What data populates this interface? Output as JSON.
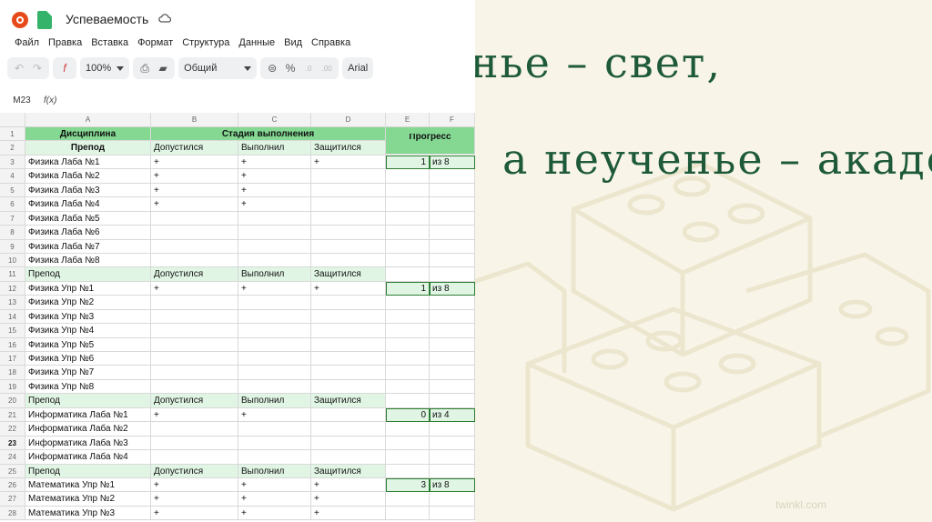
{
  "slide": {
    "line1": "Ученье – свет,",
    "line2": "а неученье – акаде",
    "watermark": "twinkl.com",
    "colors": {
      "title": "#1e5a3a",
      "background": "#f8f5e8"
    }
  },
  "app": {
    "title": "Успеваемость",
    "menu": [
      "Файл",
      "Правка",
      "Вставка",
      "Формат",
      "Структура",
      "Данные",
      "Вид",
      "Справка"
    ],
    "toolbar": {
      "zoom": "100%",
      "format": "Общий",
      "font": "Arial",
      "percent": "%",
      "dec_minus": ".0",
      "dec_plus": ".00"
    },
    "formula_bar": {
      "cell_ref": "M23",
      "fx": "f(x)"
    },
    "columns": [
      "A",
      "B",
      "C",
      "D",
      "E",
      "F"
    ],
    "header": {
      "discipline": "Дисциплина",
      "stage": "Стадия выполнения",
      "progress": "Прогресс",
      "teacher": "Препод",
      "admitted": "Допустился",
      "done": "Выполнил",
      "defended": "Защитился"
    },
    "rows": [
      {
        "n": "3",
        "a": "Физика Лаба №1",
        "b": "+",
        "c": "+",
        "d": "+",
        "e": "1",
        "f": "из 8"
      },
      {
        "n": "4",
        "a": "Физика Лаба №2",
        "b": "+",
        "c": "+",
        "d": "",
        "e": "",
        "f": ""
      },
      {
        "n": "5",
        "a": "Физика Лаба №3",
        "b": "+",
        "c": "+",
        "d": "",
        "e": "",
        "f": ""
      },
      {
        "n": "6",
        "a": "Физика Лаба №4",
        "b": "+",
        "c": "+",
        "d": "",
        "e": "",
        "f": ""
      },
      {
        "n": "7",
        "a": "Физика Лаба №5",
        "b": "",
        "c": "",
        "d": "",
        "e": "",
        "f": ""
      },
      {
        "n": "8",
        "a": "Физика Лаба №6",
        "b": "",
        "c": "",
        "d": "",
        "e": "",
        "f": ""
      },
      {
        "n": "9",
        "a": "Физика Лаба №7",
        "b": "",
        "c": "",
        "d": "",
        "e": "",
        "f": ""
      },
      {
        "n": "10",
        "a": "Физика Лаба №8",
        "b": "",
        "c": "",
        "d": "",
        "e": "",
        "f": ""
      },
      {
        "n": "11",
        "a": "Препод",
        "b": "Допустился",
        "c": "Выполнил",
        "d": "Защитился",
        "e": "",
        "f": "",
        "sub": true
      },
      {
        "n": "12",
        "a": "Физика Упр №1",
        "b": "+",
        "c": "+",
        "d": "+",
        "e": "1",
        "f": "из 8"
      },
      {
        "n": "13",
        "a": "Физика Упр №2",
        "b": "",
        "c": "",
        "d": "",
        "e": "",
        "f": ""
      },
      {
        "n": "14",
        "a": "Физика Упр №3",
        "b": "",
        "c": "",
        "d": "",
        "e": "",
        "f": ""
      },
      {
        "n": "15",
        "a": "Физика Упр №4",
        "b": "",
        "c": "",
        "d": "",
        "e": "",
        "f": ""
      },
      {
        "n": "16",
        "a": "Физика Упр №5",
        "b": "",
        "c": "",
        "d": "",
        "e": "",
        "f": ""
      },
      {
        "n": "17",
        "a": "Физика Упр №6",
        "b": "",
        "c": "",
        "d": "",
        "e": "",
        "f": ""
      },
      {
        "n": "18",
        "a": "Физика Упр №7",
        "b": "",
        "c": "",
        "d": "",
        "e": "",
        "f": ""
      },
      {
        "n": "19",
        "a": "Физика Упр №8",
        "b": "",
        "c": "",
        "d": "",
        "e": "",
        "f": ""
      },
      {
        "n": "20",
        "a": "Препод",
        "b": "Допустился",
        "c": "Выполнил",
        "d": "Защитился",
        "e": "",
        "f": "",
        "sub": true
      },
      {
        "n": "21",
        "a": "Информатика Лаба №1",
        "b": "+",
        "c": "+",
        "d": "",
        "e": "0",
        "f": "из 4"
      },
      {
        "n": "22",
        "a": "Информатика Лаба №2",
        "b": "",
        "c": "",
        "d": "",
        "e": "",
        "f": ""
      },
      {
        "n": "23",
        "a": "Информатика Лаба №3",
        "b": "",
        "c": "",
        "d": "",
        "e": "",
        "f": "",
        "hl": true
      },
      {
        "n": "24",
        "a": "Информатика Лаба №4",
        "b": "",
        "c": "",
        "d": "",
        "e": "",
        "f": ""
      },
      {
        "n": "25",
        "a": "Препод",
        "b": "Допустился",
        "c": "Выполнил",
        "d": "Защитился",
        "e": "",
        "f": "",
        "sub": true
      },
      {
        "n": "26",
        "a": "Математика Упр №1",
        "b": "+",
        "c": "+",
        "d": "+",
        "e": "3",
        "f": "из 8"
      },
      {
        "n": "27",
        "a": "Математика Упр №2",
        "b": "+",
        "c": "+",
        "d": "+",
        "e": "",
        "f": ""
      },
      {
        "n": "28",
        "a": "Математика Упр №3",
        "b": "+",
        "c": "+",
        "d": "+",
        "e": "",
        "f": ""
      }
    ]
  }
}
